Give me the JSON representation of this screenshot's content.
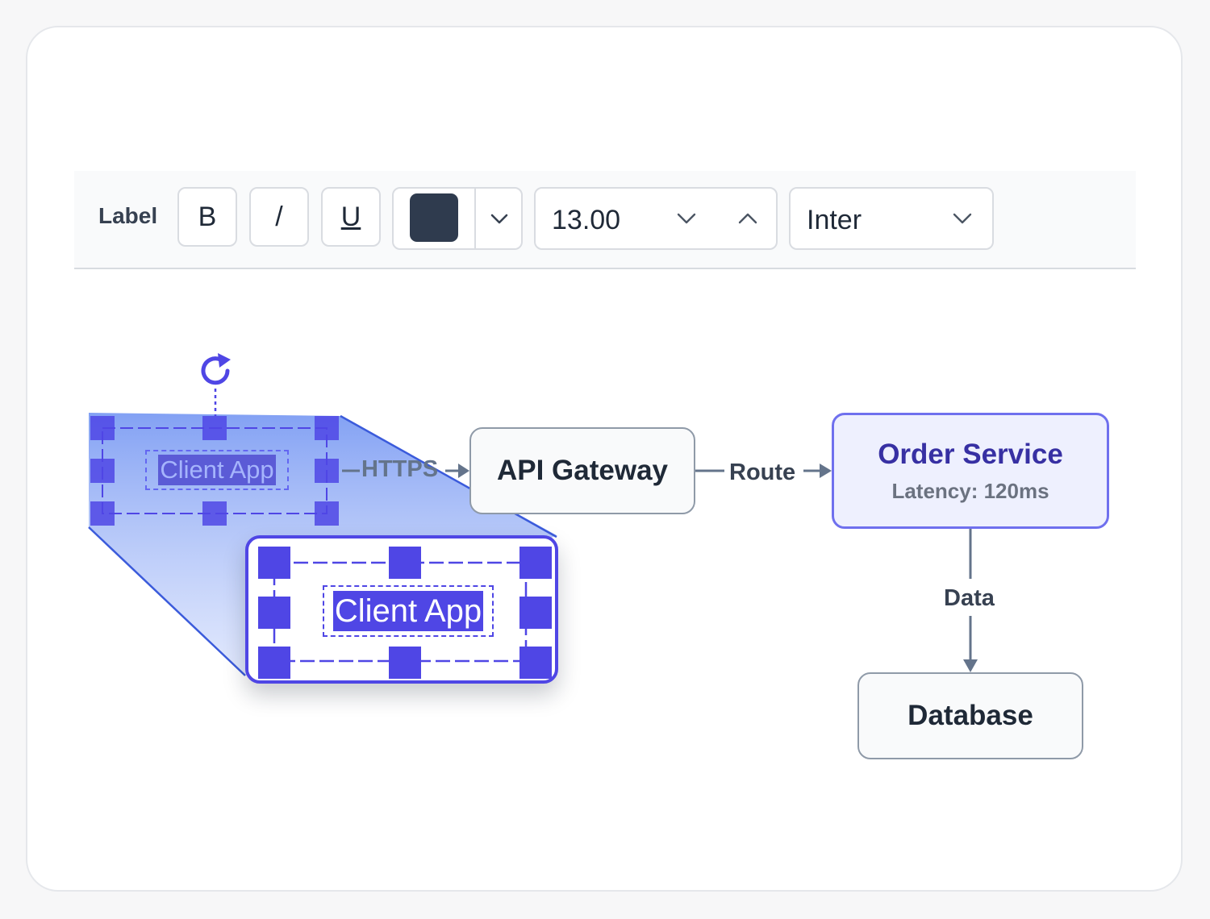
{
  "toolbar": {
    "label": "Label",
    "bold_label": "B",
    "italic_label": "/",
    "underline_label": "U",
    "color_value": "#2f3b4e",
    "font_size": "13.00",
    "font_family": "Inter"
  },
  "nodes": {
    "client": "Client App",
    "api_gateway": "API Gateway",
    "order_service": "Order Service",
    "order_service_latency": "Latency: 120ms",
    "database": "Database"
  },
  "edges": {
    "https": "HTTPS",
    "route": "Route",
    "data": "Data"
  },
  "colors": {
    "accent": "#4f46e5",
    "node_border": "#8f9aa8",
    "highlight_fill": "#eef0fe"
  },
  "icons": {
    "rotate": "rotate-icon",
    "color_dropdown": "chevron-down-icon",
    "size_decrease": "chevron-down-icon",
    "size_increase": "chevron-up-icon",
    "font_dropdown": "chevron-down-icon"
  }
}
